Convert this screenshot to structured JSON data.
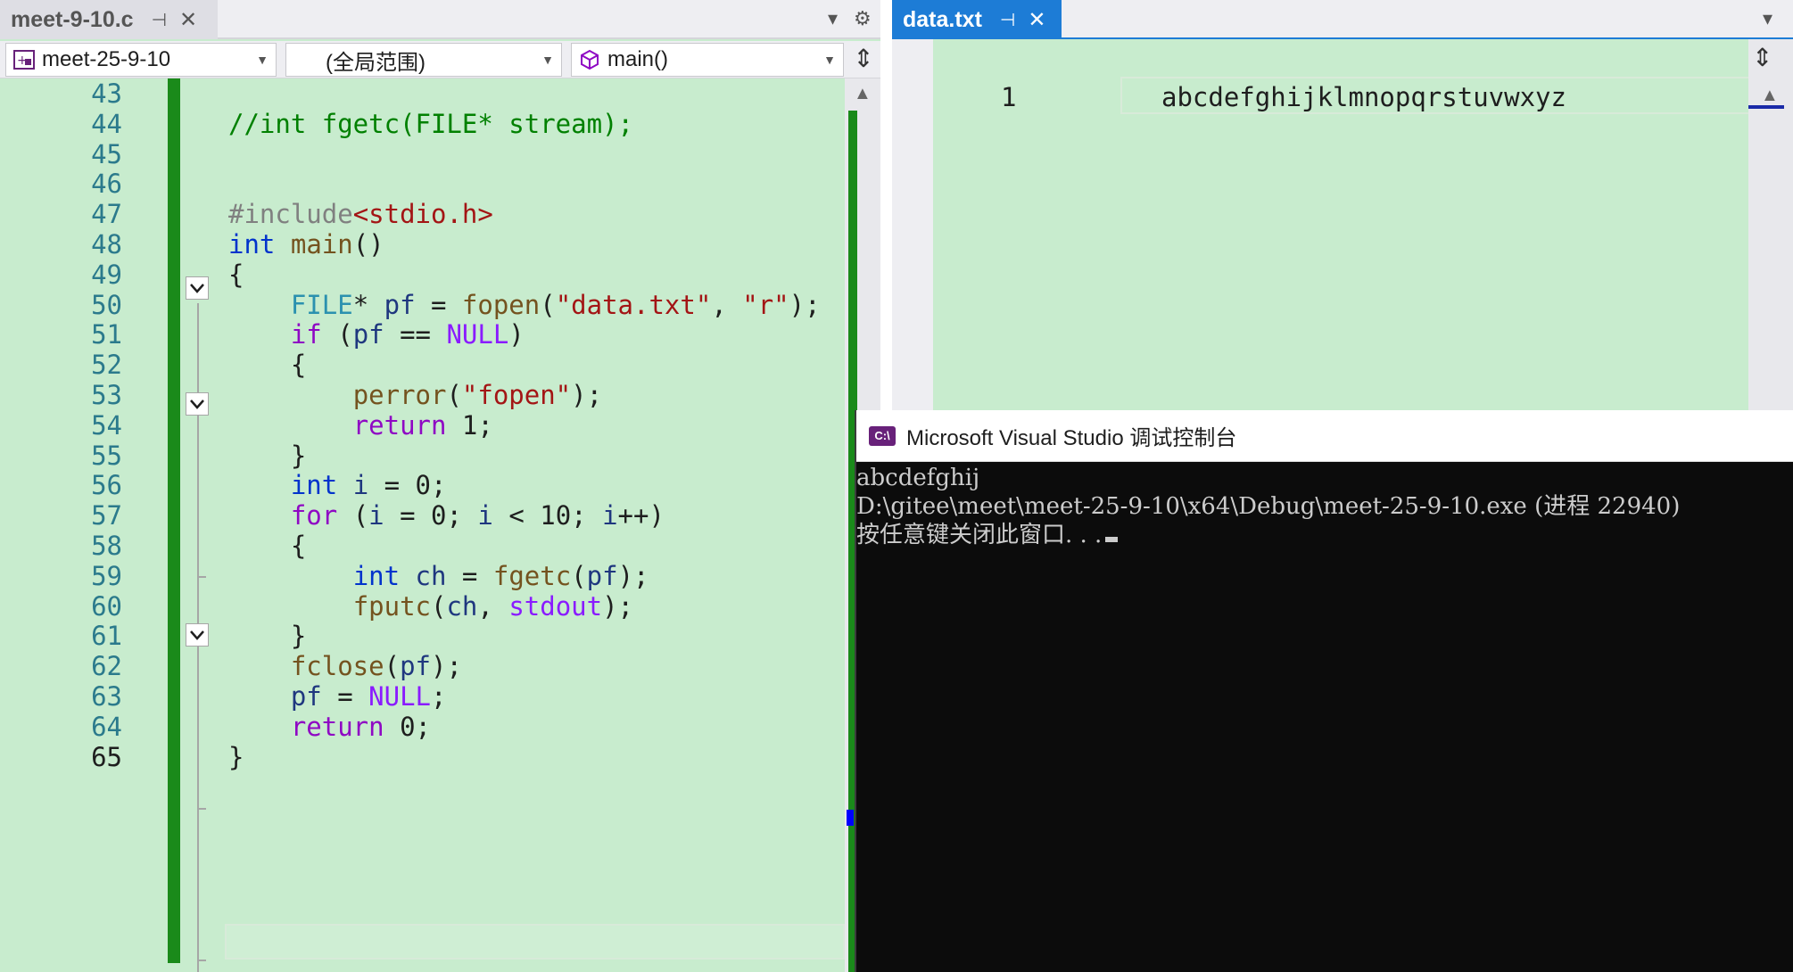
{
  "left_editor": {
    "tab": {
      "label": "meet-9-10.c",
      "pin": "⊣",
      "close": "✕"
    },
    "tab_tools": {
      "dropdown": "▾",
      "settings": "⚙"
    },
    "nav": {
      "project": "meet-25-9-10",
      "scope": "(全局范围)",
      "function": "main()"
    },
    "lines": [
      {
        "n": "43",
        "tokens": []
      },
      {
        "n": "44",
        "tokens": [
          {
            "t": "//int fgetc(FILE* stream);",
            "c": "comment"
          }
        ]
      },
      {
        "n": "45",
        "tokens": []
      },
      {
        "n": "46",
        "tokens": []
      },
      {
        "n": "47",
        "tokens": [
          {
            "t": "#include",
            "c": "preproc"
          },
          {
            "t": "<stdio.h>",
            "c": "string"
          }
        ]
      },
      {
        "n": "48",
        "tokens": [
          {
            "t": "int",
            "c": "keyword"
          },
          {
            "t": " ",
            "c": "punct"
          },
          {
            "t": "main",
            "c": "function"
          },
          {
            "t": "()",
            "c": "punct"
          }
        ]
      },
      {
        "n": "49",
        "tokens": [
          {
            "t": "{",
            "c": "punct"
          }
        ]
      },
      {
        "n": "50",
        "tokens": [
          {
            "t": "    ",
            "c": "punct"
          },
          {
            "t": "FILE",
            "c": "type"
          },
          {
            "t": "* ",
            "c": "punct"
          },
          {
            "t": "pf",
            "c": "variable"
          },
          {
            "t": " = ",
            "c": "punct"
          },
          {
            "t": "fopen",
            "c": "function"
          },
          {
            "t": "(",
            "c": "punct"
          },
          {
            "t": "\"data.txt\"",
            "c": "string"
          },
          {
            "t": ", ",
            "c": "punct"
          },
          {
            "t": "\"r\"",
            "c": "string"
          },
          {
            "t": ");",
            "c": "punct"
          }
        ]
      },
      {
        "n": "51",
        "tokens": [
          {
            "t": "    ",
            "c": "punct"
          },
          {
            "t": "if",
            "c": "control"
          },
          {
            "t": " (",
            "c": "punct"
          },
          {
            "t": "pf",
            "c": "variable"
          },
          {
            "t": " == ",
            "c": "punct"
          },
          {
            "t": "NULL",
            "c": "macro"
          },
          {
            "t": ")",
            "c": "punct"
          }
        ]
      },
      {
        "n": "52",
        "tokens": [
          {
            "t": "    {",
            "c": "punct"
          }
        ]
      },
      {
        "n": "53",
        "tokens": [
          {
            "t": "        ",
            "c": "punct"
          },
          {
            "t": "perror",
            "c": "function"
          },
          {
            "t": "(",
            "c": "punct"
          },
          {
            "t": "\"fopen\"",
            "c": "string"
          },
          {
            "t": ");",
            "c": "punct"
          }
        ]
      },
      {
        "n": "54",
        "tokens": [
          {
            "t": "        ",
            "c": "punct"
          },
          {
            "t": "return",
            "c": "control"
          },
          {
            "t": " 1;",
            "c": "punct"
          }
        ]
      },
      {
        "n": "55",
        "tokens": [
          {
            "t": "    }",
            "c": "punct"
          }
        ]
      },
      {
        "n": "56",
        "tokens": [
          {
            "t": "    ",
            "c": "punct"
          },
          {
            "t": "int",
            "c": "keyword"
          },
          {
            "t": " ",
            "c": "punct"
          },
          {
            "t": "i",
            "c": "variable"
          },
          {
            "t": " = 0;",
            "c": "punct"
          }
        ]
      },
      {
        "n": "57",
        "tokens": [
          {
            "t": "    ",
            "c": "punct"
          },
          {
            "t": "for",
            "c": "control"
          },
          {
            "t": " (",
            "c": "punct"
          },
          {
            "t": "i",
            "c": "variable"
          },
          {
            "t": " = 0; ",
            "c": "punct"
          },
          {
            "t": "i",
            "c": "variable"
          },
          {
            "t": " < 10; ",
            "c": "punct"
          },
          {
            "t": "i",
            "c": "variable"
          },
          {
            "t": "++)",
            "c": "punct"
          }
        ]
      },
      {
        "n": "58",
        "tokens": [
          {
            "t": "    {",
            "c": "punct"
          }
        ]
      },
      {
        "n": "59",
        "tokens": [
          {
            "t": "        ",
            "c": "punct"
          },
          {
            "t": "int",
            "c": "keyword"
          },
          {
            "t": " ",
            "c": "punct"
          },
          {
            "t": "ch",
            "c": "variable"
          },
          {
            "t": " = ",
            "c": "punct"
          },
          {
            "t": "fgetc",
            "c": "function"
          },
          {
            "t": "(",
            "c": "punct"
          },
          {
            "t": "pf",
            "c": "variable"
          },
          {
            "t": ");",
            "c": "punct"
          }
        ]
      },
      {
        "n": "60",
        "tokens": [
          {
            "t": "        ",
            "c": "punct"
          },
          {
            "t": "fputc",
            "c": "function"
          },
          {
            "t": "(",
            "c": "punct"
          },
          {
            "t": "ch",
            "c": "variable"
          },
          {
            "t": ", ",
            "c": "punct"
          },
          {
            "t": "stdout",
            "c": "macro"
          },
          {
            "t": ");",
            "c": "punct"
          }
        ]
      },
      {
        "n": "61",
        "tokens": [
          {
            "t": "    }",
            "c": "punct"
          }
        ]
      },
      {
        "n": "62",
        "tokens": [
          {
            "t": "    ",
            "c": "punct"
          },
          {
            "t": "fclose",
            "c": "function"
          },
          {
            "t": "(",
            "c": "punct"
          },
          {
            "t": "pf",
            "c": "variable"
          },
          {
            "t": ");",
            "c": "punct"
          }
        ]
      },
      {
        "n": "63",
        "tokens": [
          {
            "t": "    ",
            "c": "punct"
          },
          {
            "t": "pf",
            "c": "variable"
          },
          {
            "t": " = ",
            "c": "punct"
          },
          {
            "t": "NULL",
            "c": "macro"
          },
          {
            "t": ";",
            "c": "punct"
          }
        ]
      },
      {
        "n": "64",
        "tokens": [
          {
            "t": "    ",
            "c": "punct"
          },
          {
            "t": "return",
            "c": "control"
          },
          {
            "t": " 0;",
            "c": "punct"
          }
        ]
      },
      {
        "n": "65",
        "tokens": [
          {
            "t": "}",
            "c": "punct"
          }
        ]
      }
    ],
    "current_line": "65"
  },
  "right_editor": {
    "tab": {
      "label": "data.txt",
      "pin": "⊣",
      "close": "✕"
    },
    "tab_tools": {
      "dropdown": "▾"
    },
    "line_number": "1",
    "text": "abcdefghijklmnopqrstuvwxyz"
  },
  "console": {
    "title": "Microsoft Visual Studio 调试控制台",
    "icon_text": "C:\\",
    "lines": [
      "abcdefghij",
      "D:\\gitee\\meet\\meet-25-9-10\\x64\\Debug\\meet-25-9-10.exe (进程 22940)",
      "按任意键关闭此窗口. . ."
    ]
  },
  "colors": {
    "editor_bg": "#c8ecce",
    "change_bar": "#1a8a1a",
    "active_tab": "#1d7cd6",
    "console_bg": "#0c0c0c",
    "console_text": "#cccccc"
  }
}
